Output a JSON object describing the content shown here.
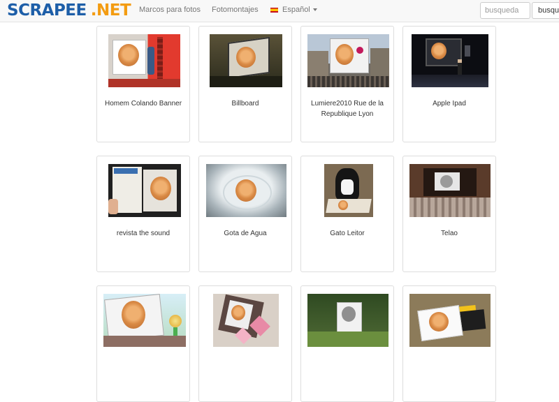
{
  "header": {
    "logo_main": "SCRAPEE",
    "logo_suffix": ".NET",
    "links": [
      "Marcos para fotos",
      "Fotomontajes"
    ],
    "language": "Español",
    "search_placeholder": "busqueda",
    "search_button": "busqueda"
  },
  "cards": [
    {
      "title": "Homem Colando Banner"
    },
    {
      "title": "Billboard"
    },
    {
      "title": "Lumiere2010 Rue de la Republique Lyon"
    },
    {
      "title": "Apple Ipad"
    },
    {
      "title": "revista the sound"
    },
    {
      "title": "Gota de Agua"
    },
    {
      "title": "Gato Leitor"
    },
    {
      "title": "Telao"
    },
    {
      "title": ""
    },
    {
      "title": ""
    },
    {
      "title": ""
    },
    {
      "title": ""
    }
  ],
  "colors": {
    "logo_blue": "#1d5ea8",
    "logo_orange": "#f39c12",
    "navbar_bg": "#f8f8f8",
    "card_border": "#dddddd"
  }
}
